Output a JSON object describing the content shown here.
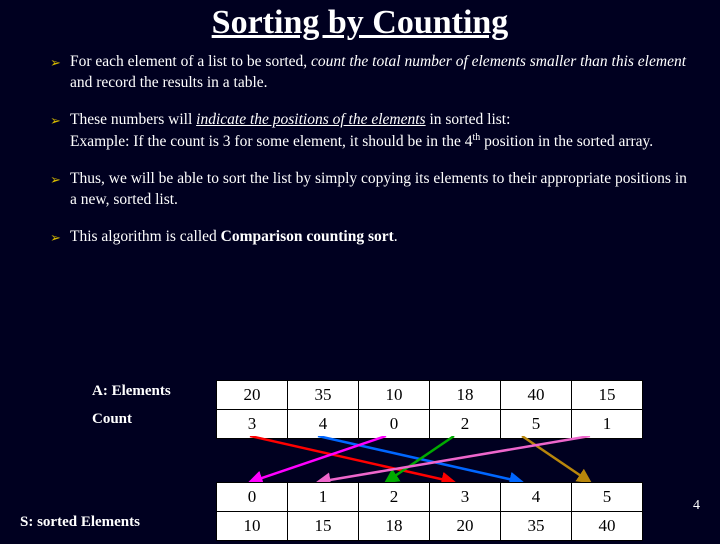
{
  "title": "Sorting by Counting",
  "bullets": {
    "b1a": "For each element of a list to be sorted, ",
    "b1b": "count the total number of elements smaller than this element",
    "b1c": " and record the results in a table.",
    "b2a": "These numbers will ",
    "b2b": "indicate the positions of the elements",
    "b2c": " in sorted list:",
    "b2d": "Example: If the count is 3 for some element, it should be in the 4",
    "b2e": "th",
    "b2f": " position in the sorted array.",
    "b3": "Thus, we will be able to sort the list by simply copying its elements to their appropriate positions in a new, sorted list.",
    "b4a": "This algorithm is called ",
    "b4b": "Comparison counting sort",
    "b4c": "."
  },
  "labels": {
    "a": "A: Elements",
    "count": "Count",
    "s": "S: sorted Elements"
  },
  "table1": {
    "r0": [
      "20",
      "35",
      "10",
      "18",
      "40",
      "15"
    ],
    "r1": [
      "3",
      "4",
      "0",
      "2",
      "5",
      "1"
    ]
  },
  "table2": {
    "r0": [
      "0",
      "1",
      "2",
      "3",
      "4",
      "5"
    ],
    "r1": [
      "10",
      "15",
      "18",
      "20",
      "35",
      "40"
    ]
  },
  "page": "4",
  "chart_data": {
    "type": "table",
    "title": "Sorting by Counting",
    "elements": [
      20,
      35,
      10,
      18,
      40,
      15
    ],
    "count": [
      3,
      4,
      0,
      2,
      5,
      1
    ],
    "sorted_index": [
      0,
      1,
      2,
      3,
      4,
      5
    ],
    "sorted_values": [
      10,
      15,
      18,
      20,
      35,
      40
    ],
    "arrows_from_count_col_to_sorted_col": [
      {
        "from": 0,
        "to": 3,
        "color": "#ff0000"
      },
      {
        "from": 1,
        "to": 4,
        "color": "#0066ff"
      },
      {
        "from": 2,
        "to": 0,
        "color": "#ff00ff"
      },
      {
        "from": 3,
        "to": 2,
        "color": "#00aa00"
      },
      {
        "from": 4,
        "to": 5,
        "color": "#b8860b"
      },
      {
        "from": 5,
        "to": 1,
        "color": "#ee66cc"
      }
    ]
  }
}
